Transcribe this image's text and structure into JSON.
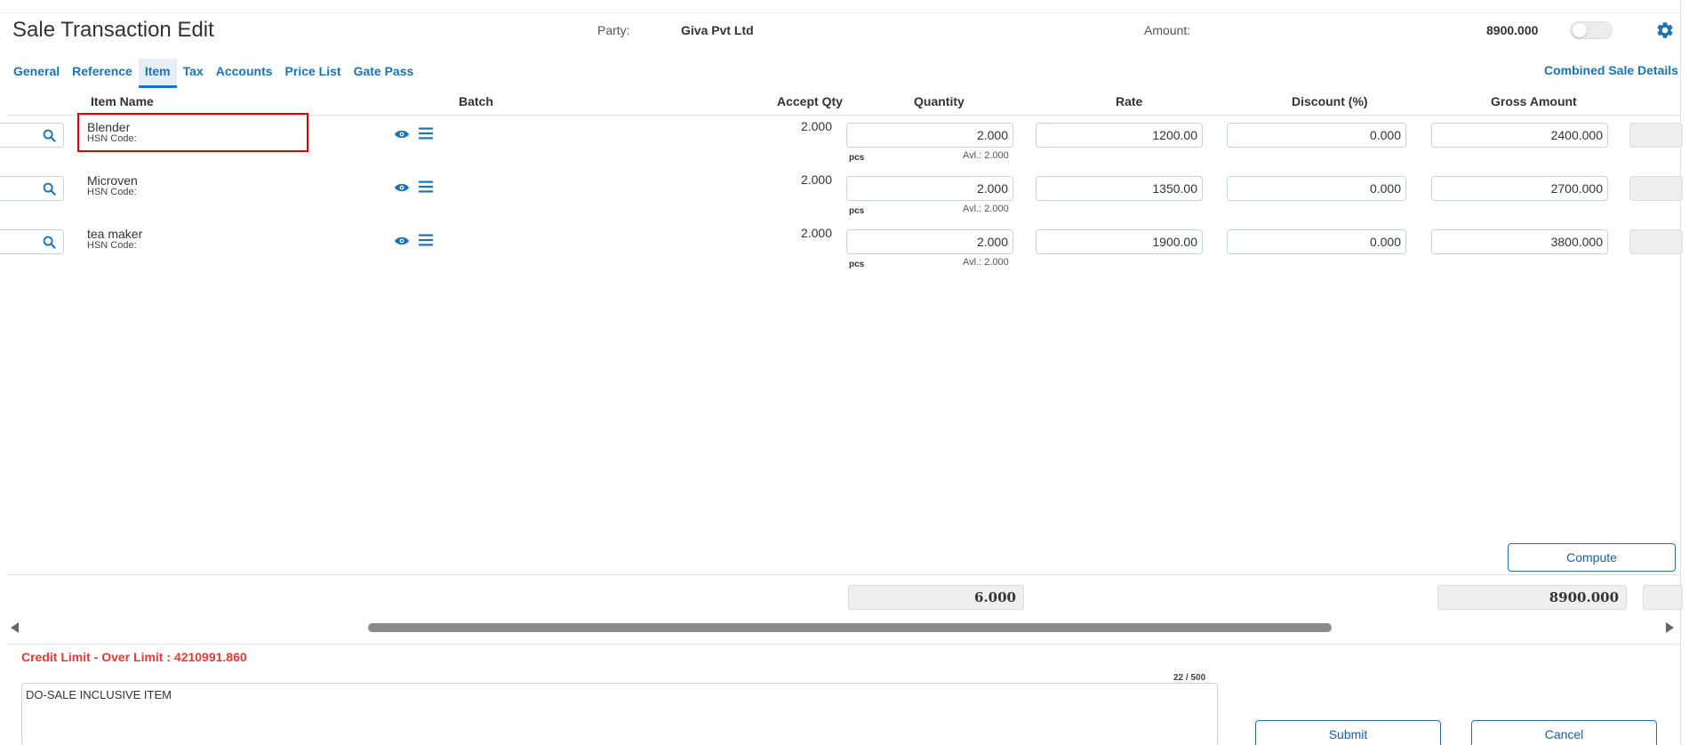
{
  "header": {
    "title": "Sale Transaction Edit",
    "party_label": "Party:",
    "party_value": "Giva Pvt Ltd",
    "amount_label": "Amount:",
    "amount_value": "8900.000",
    "toggle_on": false
  },
  "tabs": [
    {
      "label": "General",
      "active": false
    },
    {
      "label": "Reference",
      "active": false
    },
    {
      "label": "Item",
      "active": true
    },
    {
      "label": "Tax",
      "active": false
    },
    {
      "label": "Accounts",
      "active": false
    },
    {
      "label": "Price List",
      "active": false
    },
    {
      "label": "Gate Pass",
      "active": false
    }
  ],
  "combined_link": "Combined Sale Details",
  "columns": {
    "item_name": "Item Name",
    "batch": "Batch",
    "accept_qty": "Accept Qty",
    "quantity": "Quantity",
    "rate": "Rate",
    "discount": "Discount (%)",
    "gross_amount": "Gross Amount"
  },
  "rows": [
    {
      "item_name": "Blender",
      "hsn": "HSN Code:",
      "accept_qty": "2.000",
      "quantity": "2.000",
      "unit": "pcs",
      "available": "Avl.: 2.000",
      "rate": "1200.00",
      "discount": "0.000",
      "gross_amount": "2400.000"
    },
    {
      "item_name": "Microven",
      "hsn": "HSN Code:",
      "accept_qty": "2.000",
      "quantity": "2.000",
      "unit": "pcs",
      "available": "Avl.: 2.000",
      "rate": "1350.00",
      "discount": "0.000",
      "gross_amount": "2700.000"
    },
    {
      "item_name": "tea maker",
      "hsn": "HSN Code:",
      "accept_qty": "2.000",
      "quantity": "2.000",
      "unit": "pcs",
      "available": "Avl.: 2.000",
      "rate": "1900.00",
      "discount": "0.000",
      "gross_amount": "3800.000"
    }
  ],
  "compute_label": "Compute",
  "totals": {
    "quantity": "6.000",
    "gross_amount": "8900.000"
  },
  "footer": {
    "credit_limit": "Credit Limit - Over Limit : 4210991.860",
    "char_counter": "22 / 500",
    "remarks": "DO-SALE INCLUSIVE ITEM",
    "submit_label": "Submit",
    "cancel_label": "Cancel"
  },
  "colors": {
    "accent": "#1a73b9",
    "error": "#e53935",
    "highlight": "#e00000"
  },
  "icons": {
    "settings": "gear-icon",
    "row_search": "search-icon",
    "row_view": "eye-icon",
    "row_menu": "menu-icon"
  }
}
